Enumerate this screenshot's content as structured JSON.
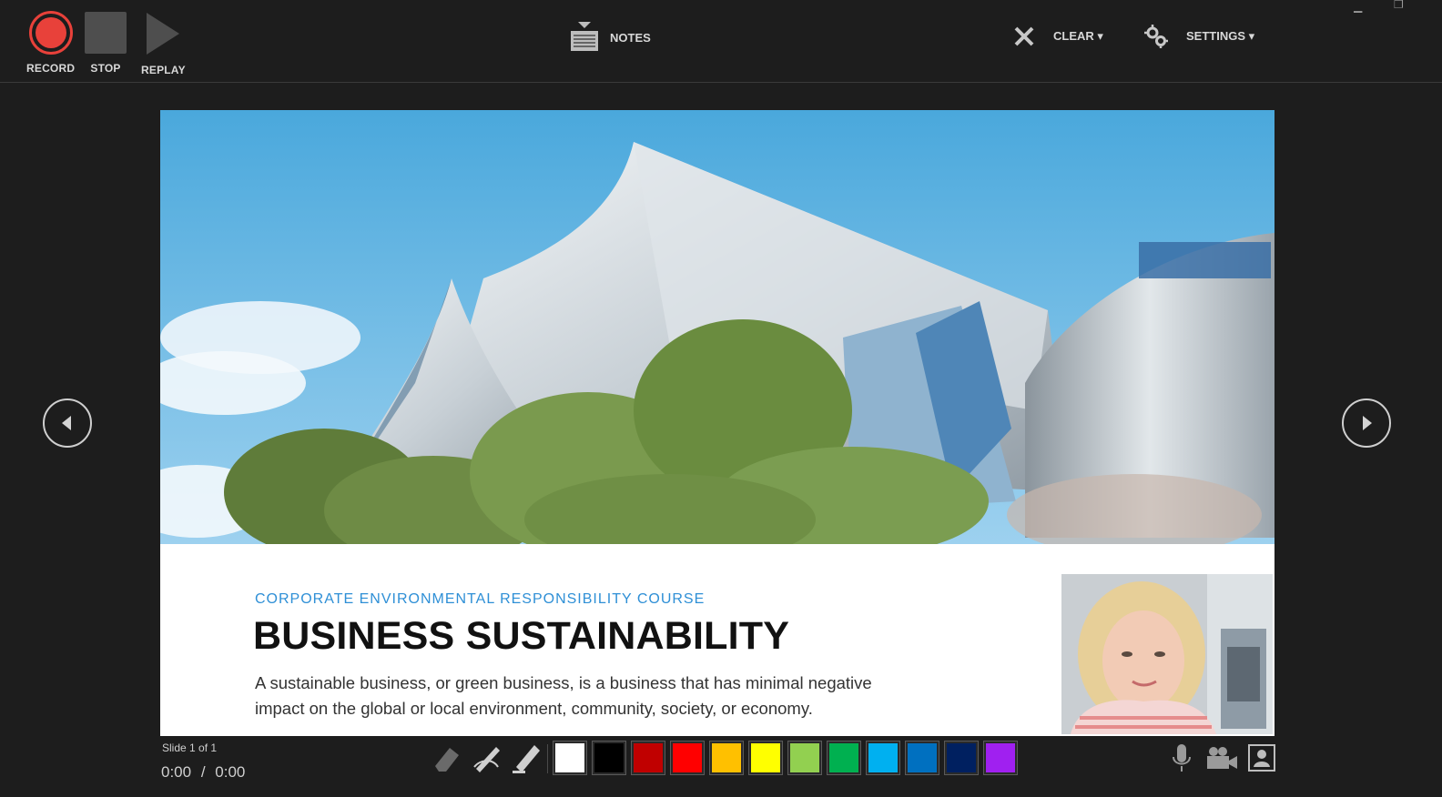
{
  "toolbar": {
    "record_label": "RECORD",
    "stop_label": "STOP",
    "replay_label": "REPLAY",
    "notes_label": "NOTES",
    "clear_label": "CLEAR ▾",
    "settings_label": "SETTINGS ▾"
  },
  "slide": {
    "subtitle": "CORPORATE ENVIRONMENTAL RESPONSIBILITY COURSE",
    "title": "BUSINESS SUSTAINABILITY",
    "body": "A sustainable business, or green business, is a business that has minimal negative impact on the global or local environment, community, society, or economy."
  },
  "status": {
    "slide_count": "Slide 1 of 1",
    "elapsed": "0:00",
    "separator": "/",
    "total": "0:00"
  },
  "pen_colors": [
    "#ffffff",
    "#000000",
    "#c00000",
    "#ff0000",
    "#ffc000",
    "#ffff00",
    "#92d050",
    "#00b050",
    "#00b0f0",
    "#0070c0",
    "#002060",
    "#a020f0"
  ],
  "icons": {
    "record": "record-icon",
    "stop": "stop-icon",
    "replay": "replay-icon",
    "notes": "notes-icon",
    "clear": "clear-x-icon",
    "settings": "settings-gear-icon",
    "prev": "previous-slide-icon",
    "next": "next-slide-icon",
    "eraser": "eraser-icon",
    "pen": "pen-icon",
    "highlighter": "highlighter-icon",
    "mic": "microphone-icon",
    "camera": "camera-icon",
    "camera_preview": "camera-preview-icon"
  },
  "colors": {
    "background": "#1d1d1d",
    "record_red": "#e8413a",
    "subtitle_blue": "#2e8fd6"
  }
}
